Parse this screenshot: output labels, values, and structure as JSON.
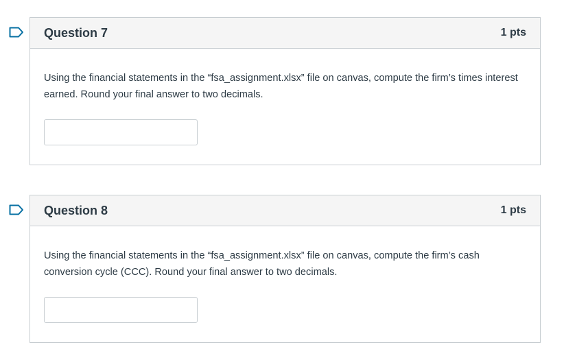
{
  "questions": [
    {
      "title": "Question 7",
      "points": "1 pts",
      "text": "Using the financial statements in the “fsa_assignment.xlsx” file on canvas, compute the firm’s times interest earned.  Round your final answer to two decimals.",
      "answer_value": "",
      "flag_icon": "bookmark-flag-icon"
    },
    {
      "title": "Question 8",
      "points": "1 pts",
      "text": "Using the financial statements in the “fsa_assignment.xlsx” file on canvas, compute the firm’s cash conversion cycle (CCC).  Round your final answer to two decimals.",
      "answer_value": "",
      "flag_icon": "bookmark-flag-icon"
    }
  ],
  "colors": {
    "flag": "#0770a3",
    "header_bg": "#f5f5f5",
    "border": "#c7cdd1",
    "text": "#2d3b45"
  }
}
